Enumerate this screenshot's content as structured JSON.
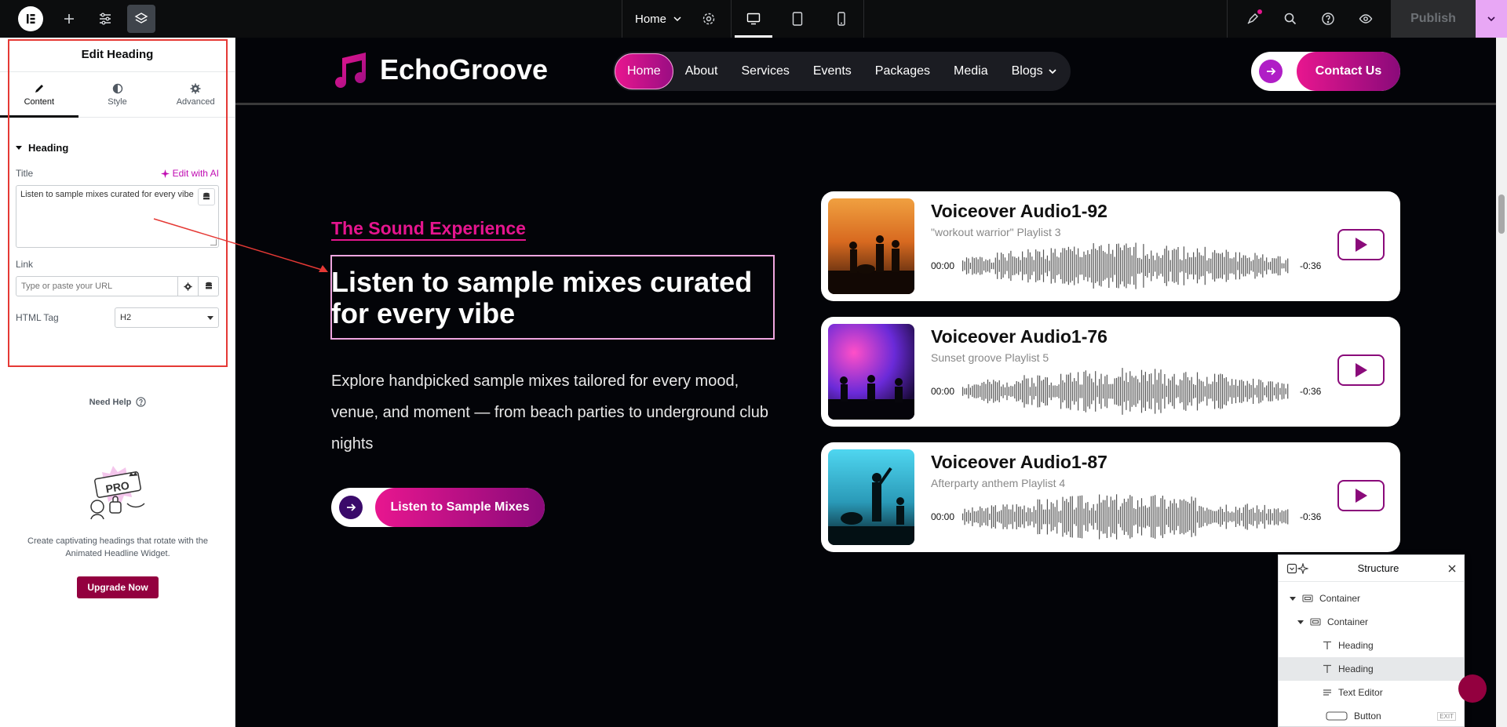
{
  "topbar": {
    "page_name": "Home",
    "publish_label": "Publish"
  },
  "panel": {
    "title": "Edit Heading",
    "tabs": [
      {
        "label": "Content",
        "icon": "pencil-icon"
      },
      {
        "label": "Style",
        "icon": "half-circle-icon"
      },
      {
        "label": "Advanced",
        "icon": "gear-icon"
      }
    ],
    "section": "Heading",
    "title_label": "Title",
    "ai_label": "Edit with AI",
    "title_value": "Listen to sample mixes curated for every vibe",
    "link_label": "Link",
    "link_placeholder": "Type or paste your URL",
    "html_tag_label": "HTML Tag",
    "html_tag_value": "H2",
    "need_help": "Need Help",
    "promo_text": "Create captivating headings that rotate with the Animated Headline Widget.",
    "upgrade_label": "Upgrade Now",
    "promo_badge": "PRO"
  },
  "site": {
    "brand": "EchoGroove",
    "nav": [
      {
        "label": "Home"
      },
      {
        "label": "About"
      },
      {
        "label": "Services"
      },
      {
        "label": "Events"
      },
      {
        "label": "Packages"
      },
      {
        "label": "Media"
      },
      {
        "label": "Blogs"
      }
    ],
    "contact_label": "Contact Us",
    "kicker": "The Sound Experience",
    "headline": "Listen to sample mixes curated for every vibe",
    "body": "Explore handpicked sample mixes tailored for every mood, venue, and moment — from beach parties to underground club nights",
    "cta_label": "Listen to Sample Mixes",
    "tracks": [
      {
        "title": "Voiceover Audio1-92",
        "subtitle": "\"workout warrior\" Playlist 3",
        "start": "00:00",
        "end": "-0:36"
      },
      {
        "title": "Voiceover Audio1-76",
        "subtitle": "Sunset groove Playlist 5",
        "start": "00:00",
        "end": "-0:36"
      },
      {
        "title": "Voiceover Audio1-87",
        "subtitle": "Afterparty anthem Playlist 4",
        "start": "00:00",
        "end": "-0:36"
      }
    ]
  },
  "structure": {
    "title": "Structure",
    "items": [
      {
        "label": "Container"
      },
      {
        "label": "Container"
      },
      {
        "label": "Heading"
      },
      {
        "label": "Heading"
      },
      {
        "label": "Text Editor"
      },
      {
        "label": "Button"
      }
    ],
    "exit_tag": "EXIT"
  },
  "colors": {
    "accent": "#e5158e",
    "brand_purple": "#8a0a7a",
    "upgrade": "#93003f",
    "annotation": "#e53935"
  }
}
